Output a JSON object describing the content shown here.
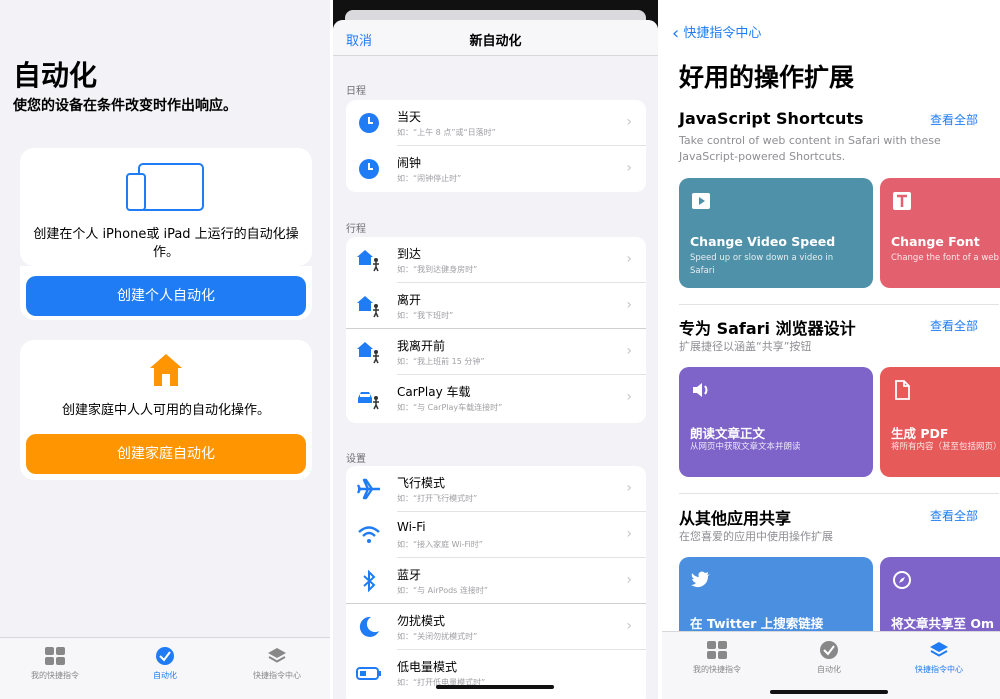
{
  "automation": {
    "title": "自动化",
    "subtitle": "使您的设备在条件改变时作出响应。",
    "personal_card": {
      "description": "创建在个人 iPhone或 iPad 上运行的自动化操作。",
      "button_label": "创建个人自动化",
      "button_color": "#1f7cf5"
    },
    "home_card": {
      "description": "创建家庭中人人可用的自动化操作。",
      "button_label": "创建家庭自动化",
      "button_color": "#ff9500"
    },
    "tabbar": {
      "items": [
        {
          "label": "我的快捷指令",
          "icon": "grid-icon",
          "active": false
        },
        {
          "label": "自动化",
          "icon": "checkmark-clock-icon",
          "active": true
        },
        {
          "label": "快捷指令中心",
          "icon": "layers-icon",
          "active": false
        }
      ]
    }
  },
  "new_automation": {
    "cancel_label": "取消",
    "title": "新自动化",
    "sections": [
      {
        "header": "日程",
        "rows": [
          {
            "title": "当天",
            "subtitle": "如：“上午 8 点”或“日落时”",
            "icon": "clock-icon"
          },
          {
            "title": "闹钟",
            "subtitle": "如：“闹钟停止时”",
            "icon": "clock-icon"
          }
        ]
      },
      {
        "header": "行程",
        "rows": [
          {
            "title": "到达",
            "subtitle": "如：“我到达健身房时”",
            "icon": "home-person-icon"
          },
          {
            "title": "离开",
            "subtitle": "如：“我下班时”",
            "icon": "home-person-icon"
          },
          {
            "title": "我离开前",
            "subtitle": "如：“我上班前 15 分钟”",
            "icon": "home-person-icon"
          },
          {
            "title": "CarPlay 车载",
            "subtitle": "如：“与 CarPlay车载连接时”",
            "icon": "car-person-icon"
          }
        ]
      },
      {
        "header": "设置",
        "rows": [
          {
            "title": "飞行模式",
            "subtitle": "如：“打开飞行模式时”",
            "icon": "airplane-icon"
          },
          {
            "title": "Wi-Fi",
            "subtitle": "如：“接入家庭 Wi-Fi时”",
            "icon": "wifi-icon"
          },
          {
            "title": "蓝牙",
            "subtitle": "如：“与 AirPods 连接时”",
            "icon": "bluetooth-icon"
          },
          {
            "title": "勿扰模式",
            "subtitle": "如：“关闭勿扰模式时”",
            "icon": "moon-icon"
          },
          {
            "title": "低电量模式",
            "subtitle": "如：“打开低电量模式时”",
            "icon": "battery-icon"
          }
        ]
      }
    ]
  },
  "gallery": {
    "back_label": "快捷指令中心",
    "title": "好用的操作扩展",
    "see_all": "查看全部",
    "sections": [
      {
        "title": "JavaScript Shortcuts",
        "description": "Take control of web content in Safari with these JavaScript-powered Shortcuts.",
        "tiles": [
          {
            "title": "Change Video Speed",
            "subtitle": "Speed up or slow down a video in Safari",
            "color": "#4f91a8",
            "icon": "play-icon"
          },
          {
            "title": "Change Font",
            "subtitle": "Change the font of a web page",
            "color": "#e3606f",
            "icon": "text-icon"
          }
        ]
      },
      {
        "title": "专为 Safari 浏览器设计",
        "description": "扩展捷径以涵盖“共享”按钮",
        "tiles": [
          {
            "title": "朗读文章正文",
            "subtitle": "从网页中获取文章文本并朗读",
            "color": "#7e63c8",
            "icon": "speaker-icon"
          },
          {
            "title": "生成 PDF",
            "subtitle": "将所有内容（甚至包括网页）转换为 PDF",
            "color": "#e65a5a",
            "icon": "document-icon"
          }
        ]
      },
      {
        "title": "从其他应用共享",
        "description": "在您喜爱的应用中使用操作扩展",
        "tiles": [
          {
            "title": "在 Twitter 上搜索链接",
            "subtitle": "",
            "color": "#4a8fe0",
            "icon": "twitter-icon"
          },
          {
            "title": "将文章共享至 Om",
            "subtitle": "",
            "color": "#7e63c8",
            "icon": "compass-icon"
          }
        ]
      }
    ],
    "tabbar": {
      "items": [
        {
          "label": "我的快捷指令",
          "icon": "grid-icon",
          "active": false
        },
        {
          "label": "自动化",
          "icon": "checkmark-clock-icon",
          "active": false
        },
        {
          "label": "快捷指令中心",
          "icon": "layers-icon",
          "active": true
        }
      ]
    }
  }
}
